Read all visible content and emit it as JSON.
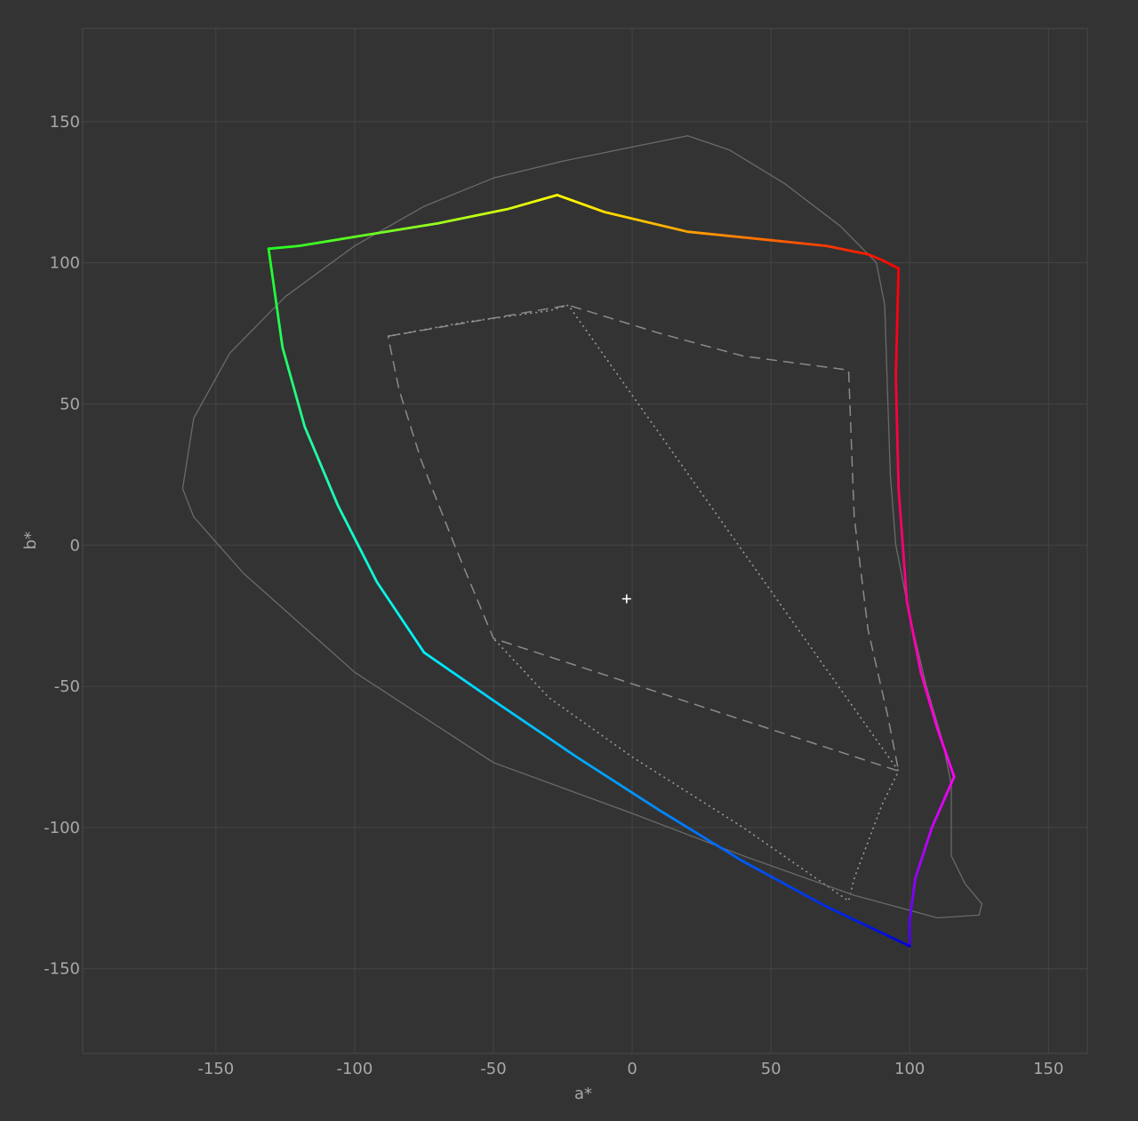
{
  "chart_data": {
    "type": "line",
    "title": "",
    "xlabel": "a*",
    "ylabel": "b*",
    "xlim": [
      -198,
      164
    ],
    "ylim": [
      -180,
      183
    ],
    "x_ticks": [
      -150,
      -100,
      -50,
      0,
      50,
      100,
      150
    ],
    "y_ticks": [
      150,
      100,
      50,
      0,
      -50,
      -100,
      -150
    ],
    "grid": true,
    "background": "#333333",
    "white_point": {
      "a": -2,
      "b": -19
    },
    "series": [
      {
        "style": "solid-gradient",
        "closed": true,
        "segments": [
          {
            "colors": [
              "#ffff00",
              "#ff8800",
              "#ff0000"
            ],
            "points": [
              [
                -27,
                124
              ],
              [
                -10,
                118
              ],
              [
                20,
                111
              ],
              [
                50,
                108
              ],
              [
                70,
                106
              ],
              [
                85,
                103
              ],
              [
                90,
                101
              ],
              [
                96,
                98
              ]
            ]
          },
          {
            "colors": [
              "#ff0000",
              "#ff0066",
              "#ff00ff"
            ],
            "points": [
              [
                96,
                98
              ],
              [
                95,
                60
              ],
              [
                96,
                20
              ],
              [
                99,
                -20
              ],
              [
                104,
                -45
              ],
              [
                110,
                -65
              ],
              [
                116,
                -82
              ]
            ]
          },
          {
            "colors": [
              "#ff00ff",
              "#aa00ff",
              "#4400ff"
            ],
            "points": [
              [
                116,
                -82
              ],
              [
                108,
                -100
              ],
              [
                102,
                -118
              ],
              [
                100,
                -133
              ],
              [
                100,
                -142
              ]
            ]
          },
          {
            "colors": [
              "#00f0ff",
              "#0088ff",
              "#0000dd"
            ],
            "points": [
              [
                -75,
                -38
              ],
              [
                -50,
                -55
              ],
              [
                -20,
                -75
              ],
              [
                10,
                -94
              ],
              [
                40,
                -112
              ],
              [
                70,
                -128
              ],
              [
                100,
                -142
              ]
            ]
          },
          {
            "colors": [
              "#22ff22",
              "#22ffaa",
              "#00f0ff"
            ],
            "points": [
              [
                -131,
                105
              ],
              [
                -126,
                70
              ],
              [
                -118,
                42
              ],
              [
                -106,
                14
              ],
              [
                -92,
                -13
              ],
              [
                -75,
                -38
              ]
            ]
          },
          {
            "colors": [
              "#22ff22",
              "#88ff22",
              "#ffff00"
            ],
            "points": [
              [
                -131,
                105
              ],
              [
                -120,
                106
              ],
              [
                -95,
                110
              ],
              [
                -70,
                114
              ],
              [
                -45,
                119
              ],
              [
                -27,
                124
              ]
            ]
          }
        ]
      },
      {
        "style": "dashed",
        "color": "#8a8a8a",
        "points": [
          [
            -88,
            74
          ],
          [
            -23,
            85
          ],
          [
            10,
            75
          ],
          [
            40,
            67
          ],
          [
            78,
            62
          ],
          [
            80,
            10
          ],
          [
            85,
            -30
          ],
          [
            92,
            -60
          ],
          [
            96,
            -80
          ],
          [
            -50,
            -33
          ],
          [
            -64,
            0
          ],
          [
            -76,
            30
          ],
          [
            -84,
            55
          ],
          [
            -88,
            74
          ]
        ]
      },
      {
        "style": "dotted",
        "color": "#9a9a9a",
        "points": [
          [
            -88,
            74
          ],
          [
            -60,
            79
          ],
          [
            -30,
            83
          ],
          [
            -23,
            85
          ],
          [
            96,
            -80
          ],
          [
            90,
            -92
          ],
          [
            85,
            -105
          ],
          [
            80,
            -118
          ],
          [
            78,
            -126
          ],
          [
            40,
            -100
          ],
          [
            0,
            -75
          ],
          [
            -30,
            -54
          ],
          [
            -50,
            -33
          ]
        ]
      },
      {
        "style": "solid-thin",
        "color": "#6a6a6a",
        "points": [
          [
            -162,
            20
          ],
          [
            -158,
            45
          ],
          [
            -145,
            68
          ],
          [
            -125,
            88
          ],
          [
            -100,
            106
          ],
          [
            -75,
            120
          ],
          [
            -50,
            130
          ],
          [
            -25,
            136
          ],
          [
            0,
            141
          ],
          [
            20,
            145
          ],
          [
            35,
            140
          ],
          [
            55,
            128
          ],
          [
            75,
            113
          ],
          [
            88,
            100
          ],
          [
            91,
            85
          ],
          [
            92,
            55
          ],
          [
            93,
            25
          ],
          [
            95,
            0
          ],
          [
            100,
            -25
          ],
          [
            106,
            -50
          ],
          [
            112,
            -70
          ],
          [
            115,
            -85
          ],
          [
            115,
            -110
          ],
          [
            120,
            -120
          ],
          [
            126,
            -127
          ],
          [
            125,
            -131
          ],
          [
            110,
            -132
          ],
          [
            80,
            -124
          ],
          [
            40,
            -110
          ],
          [
            0,
            -95
          ],
          [
            -50,
            -77
          ],
          [
            -100,
            -45
          ],
          [
            -140,
            -10
          ],
          [
            -158,
            10
          ],
          [
            -162,
            20
          ]
        ]
      }
    ]
  }
}
